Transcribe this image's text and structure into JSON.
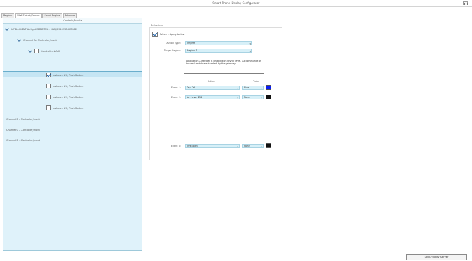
{
  "window": {
    "title": "Smart Phone Display Configurator"
  },
  "tabs": [
    {
      "label": "Regions"
    },
    {
      "label": "Wall Switch/Sensor"
    },
    {
      "label": "Smart Engine"
    },
    {
      "label": "Advance"
    }
  ],
  "left": {
    "header": "Controls/Inputs",
    "tree": [
      {
        "label": "INTELLIGENT Airlight/ADDSTCA - MAN/29401534C7882"
      },
      {
        "label": "Channel A - Controller/Input"
      },
      {
        "label": "Controller #A-0"
      },
      {
        "label": "Instance #0, Push Switch",
        "checked": true
      },
      {
        "label": "Instance #1, Push Switch"
      },
      {
        "label": "Instance #2, Push Switch"
      },
      {
        "label": "Instance #3, Push Switch"
      },
      {
        "label": "Channel B - Controller/Input"
      },
      {
        "label": "Channel C - Controller/Input"
      },
      {
        "label": "Channel D - Controller/Input"
      }
    ]
  },
  "behavior": {
    "section_title": "Behaviour",
    "active_label": "Active - Apply below",
    "action_type_label": "Action Type:",
    "action_type_value": "On/Off",
    "target_region_label": "Target Region:",
    "target_region_value": "Region 1",
    "note": "Application Controller is disabled on device level. All commands of this wall switch are handled by the gateway.",
    "col_action": "Action",
    "col_color": "Color",
    "events": [
      {
        "label": "Event 1:",
        "action": "Tap Off",
        "color_name": "Blue",
        "color_hex": "#0c1ff0"
      },
      {
        "label": "Event 2:",
        "action": "Arc level 254",
        "color_name": "None",
        "color_hex": "#111111"
      },
      {
        "label": "Event 8:",
        "action": "Unknown",
        "color_name": "None",
        "color_hex": "#111111"
      }
    ]
  },
  "footer": {
    "save_label": "Save/Modify Server"
  }
}
